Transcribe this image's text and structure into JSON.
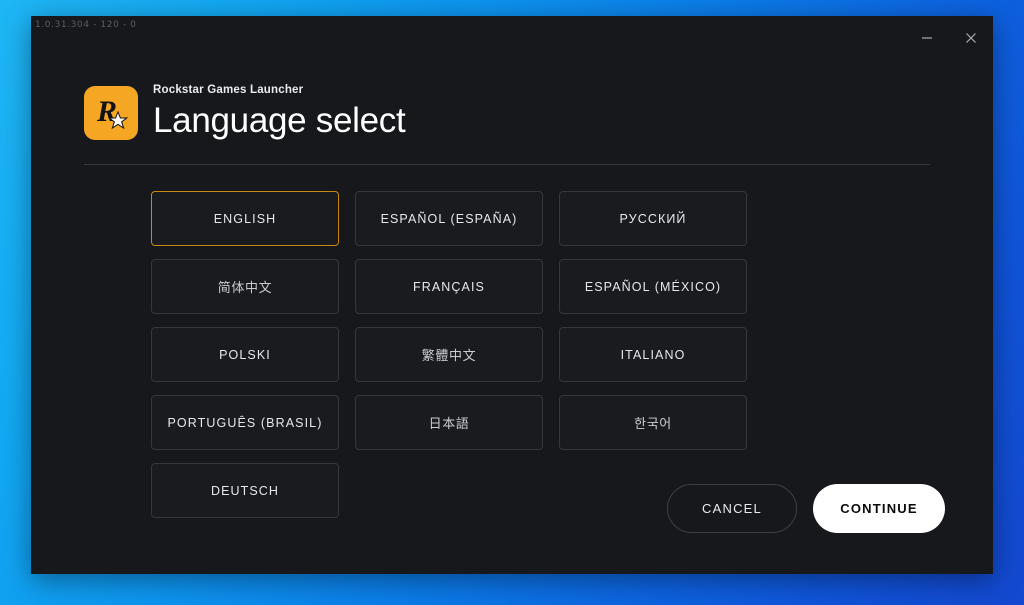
{
  "window": {
    "version_label": "1.0.31.304 - 120 - 0",
    "controls": {
      "minimize_name": "minimize-icon",
      "close_name": "close-icon"
    }
  },
  "header": {
    "subtitle": "Rockstar Games Launcher",
    "title": "Language select",
    "logo_name": "rockstar-logo"
  },
  "languages": [
    {
      "label": "ENGLISH",
      "selected": true,
      "cjk": false
    },
    {
      "label": "ESPAÑOL (ESPAÑA)",
      "selected": false,
      "cjk": false
    },
    {
      "label": "РУССКИЙ",
      "selected": false,
      "cjk": false
    },
    {
      "label": "简体中文",
      "selected": false,
      "cjk": true
    },
    {
      "label": "FRANÇAIS",
      "selected": false,
      "cjk": false
    },
    {
      "label": "ESPAÑOL (MÉXICO)",
      "selected": false,
      "cjk": false
    },
    {
      "label": "POLSKI",
      "selected": false,
      "cjk": false
    },
    {
      "label": "繁體中文",
      "selected": false,
      "cjk": true
    },
    {
      "label": "ITALIANO",
      "selected": false,
      "cjk": false
    },
    {
      "label": "PORTUGUÊS (BRASIL)",
      "selected": false,
      "cjk": false
    },
    {
      "label": "日本語",
      "selected": false,
      "cjk": true
    },
    {
      "label": "한국어",
      "selected": false,
      "cjk": true
    },
    {
      "label": "DEUTSCH",
      "selected": false,
      "cjk": false
    }
  ],
  "footer": {
    "cancel_label": "CANCEL",
    "continue_label": "CONTINUE"
  },
  "colors": {
    "accent_orange": "#f5a623",
    "selected_border": "#c8880e",
    "panel_background": "#16181c",
    "button_background": "#191b1f",
    "button_border": "#34373c",
    "desktop_gradient_start": "#1fb6f5",
    "desktop_gradient_end": "#1348cf"
  }
}
